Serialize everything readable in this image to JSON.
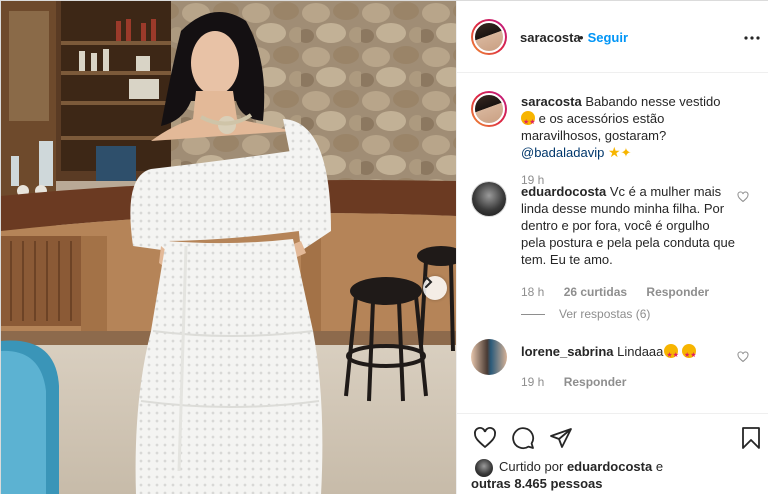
{
  "colors": {
    "accent": "#0095f6",
    "muted": "#8e8e8e",
    "text": "#262626",
    "mention": "#00376b"
  },
  "post": {
    "author": {
      "username": "saracosta",
      "follow_label": "Seguir"
    },
    "more_icon": "more-horizontal-icon",
    "carousel_next_icon": "chevron-right-icon"
  },
  "comments": [
    {
      "username": "saracosta",
      "text": "Babando nesse vestido",
      "text_mid": " e os acessórios estão maravilhosos, gostaram? ",
      "mention": "@badaladavip",
      "emojis": [
        "star-struck-emoji",
        "star-emoji",
        "sparkles-emoji"
      ],
      "time": "19 h"
    },
    {
      "username": "eduardocosta",
      "text": "Vc é a mulher mais linda desse mundo minha filha. Por dentro e por fora, você é orgulho pela postura e pela pela conduta que tem. Eu te amo.",
      "time": "18 h",
      "likes": "26 curtidas",
      "reply_label": "Responder",
      "view_replies": "Ver respostas (6)"
    },
    {
      "username": "lorene_sabrina",
      "text": "Lindaaa",
      "emojis": [
        "star-struck-emoji",
        "star-struck-emoji"
      ],
      "time": "19 h",
      "reply_label": "Responder"
    }
  ],
  "actions": {
    "like_icon": "heart-icon",
    "comment_icon": "comment-icon",
    "share_icon": "send-icon",
    "save_icon": "bookmark-icon"
  },
  "liked_by": {
    "prefix": "Curtido por",
    "user": "eduardocosta",
    "conj": "e",
    "others": "outras 8.465 pessoas"
  }
}
